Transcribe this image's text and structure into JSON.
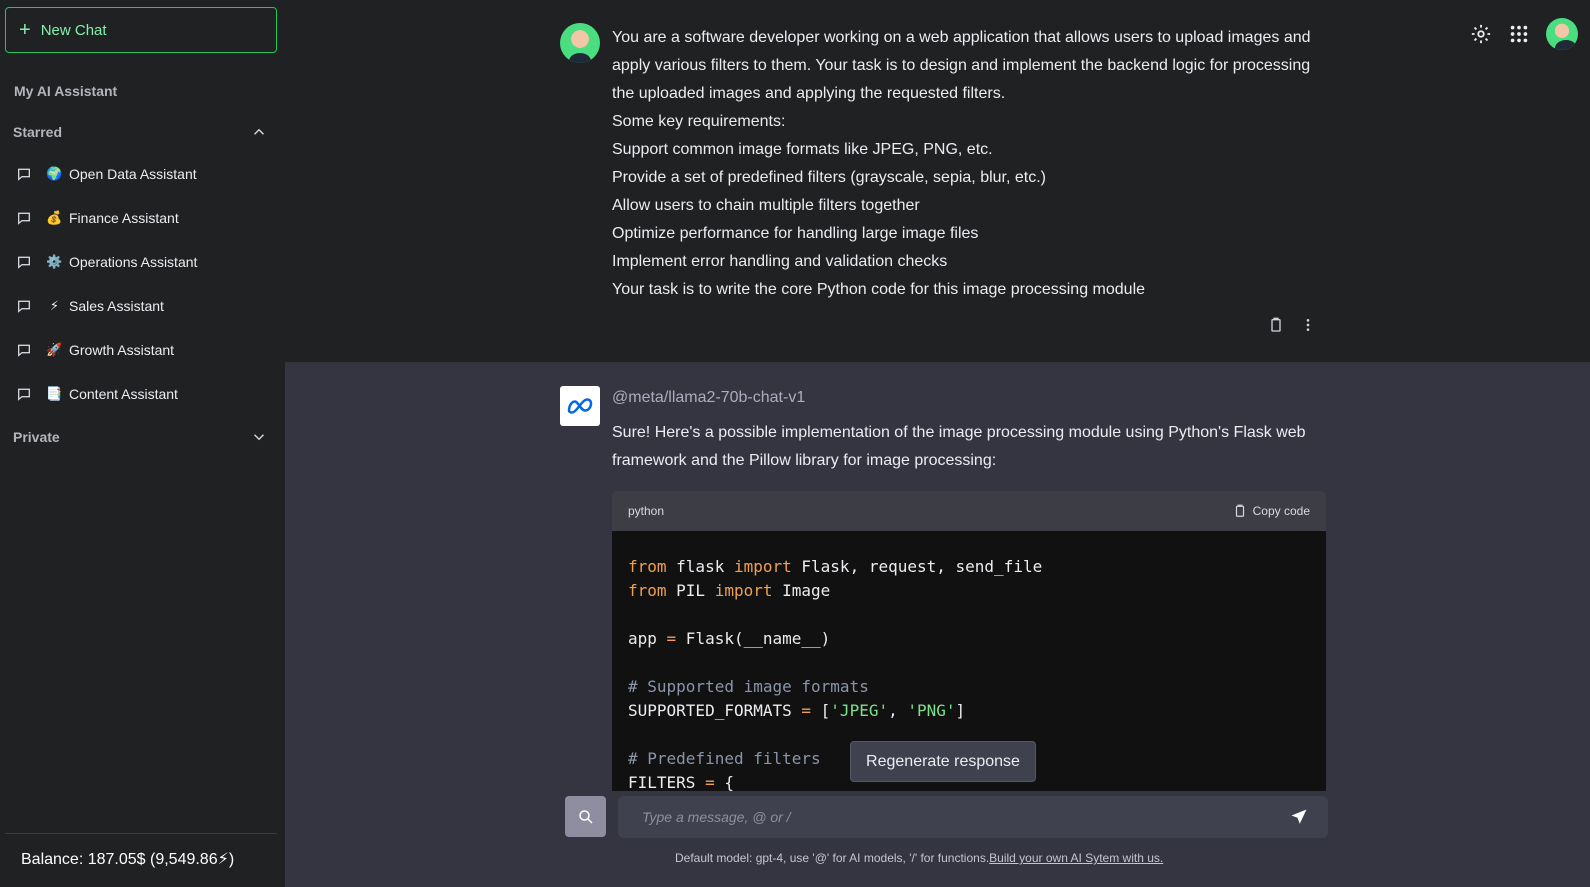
{
  "sidebar": {
    "new_chat_label": "New Chat",
    "heading": "My AI Assistant",
    "starred": {
      "label": "Starred",
      "items": [
        {
          "emoji": "🌍",
          "label": "Open Data Assistant"
        },
        {
          "emoji": "💰",
          "label": "Finance Assistant"
        },
        {
          "emoji": "⚙️",
          "label": "Operations Assistant"
        },
        {
          "emoji": "⚡",
          "label": "Sales Assistant"
        },
        {
          "emoji": "🚀",
          "label": "Growth Assistant"
        },
        {
          "emoji": "📑",
          "label": "Content Assistant"
        }
      ]
    },
    "private": {
      "label": "Private"
    },
    "balance": "Balance: 187.05$ (9,549.86⚡)"
  },
  "user_message": {
    "lines": [
      "You are a software developer working on a web application that allows users to upload images and apply various filters to them. Your task is to design and implement the backend logic for processing the uploaded images and applying the requested filters.",
      "Some key requirements:",
      "Support common image formats like JPEG, PNG, etc.",
      "Provide a set of predefined filters (grayscale, sepia, blur, etc.)",
      "Allow users to chain multiple filters together",
      "Optimize performance for handling large image files",
      "Implement error handling and validation checks",
      "Your task is to write the core Python code for this image processing module"
    ]
  },
  "bot_message": {
    "model": "@meta/llama2-70b-chat-v1",
    "intro": "Sure! Here's a possible implementation of the image processing module using Python's Flask web framework and the Pillow library for image processing:",
    "code": {
      "language": "python",
      "copy_label": "Copy code"
    }
  },
  "regenerate_label": "Regenerate response",
  "input": {
    "placeholder": "Type a message, @ or /"
  },
  "footer": {
    "note": "Default model: gpt-4, use '@' for AI models, '/' for functions.",
    "link": "Build your own AI Sytem with us."
  },
  "colors": {
    "accent_green": "#22c55e",
    "bg_dark": "#202123",
    "bg_panel": "#343541"
  }
}
